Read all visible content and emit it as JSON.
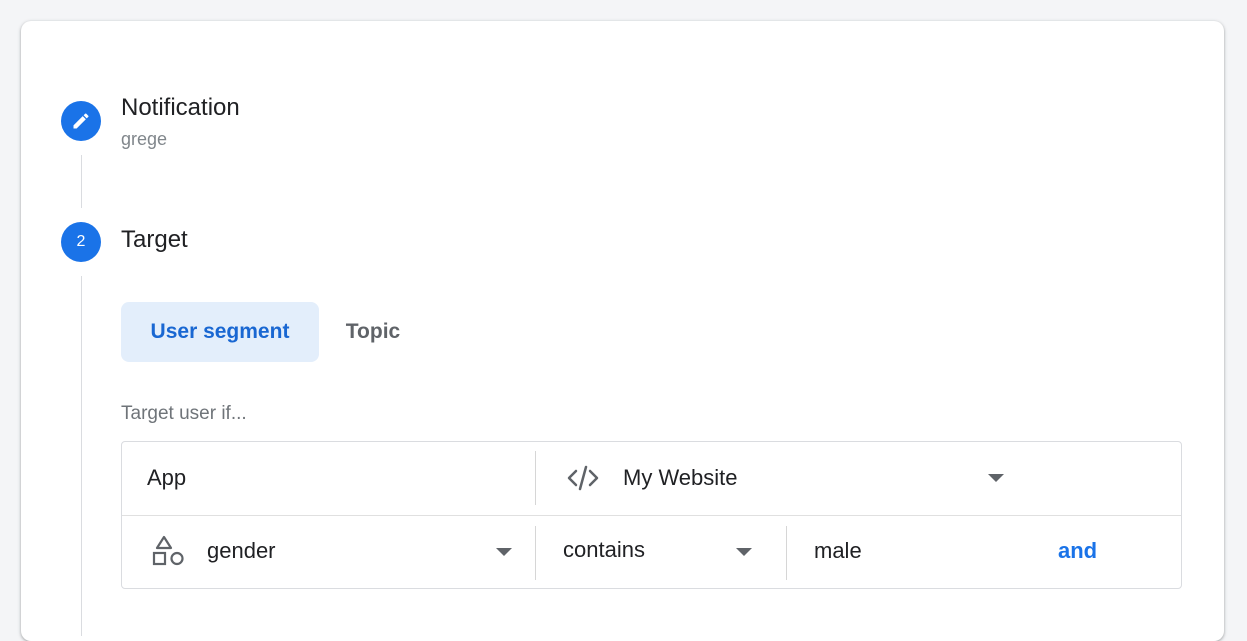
{
  "steps": [
    {
      "title": "Notification",
      "subtitle": "grege",
      "icon": "pencil-icon"
    },
    {
      "number": "2",
      "title": "Target"
    }
  ],
  "target": {
    "tabs": [
      "User segment",
      "Topic"
    ],
    "active_tab": "User segment",
    "hint": "Target user if...",
    "rows": {
      "app": {
        "label": "App",
        "icon": "code-icon",
        "value": "My Website"
      },
      "condition": {
        "icon": "shapes-icon",
        "attribute": "gender",
        "operator": "contains",
        "value": "male",
        "and_label": "and"
      }
    }
  },
  "colors": {
    "accent": "#1a73e8",
    "tab_active_bg": "#e3eefb",
    "background": "#f4f5f7"
  }
}
